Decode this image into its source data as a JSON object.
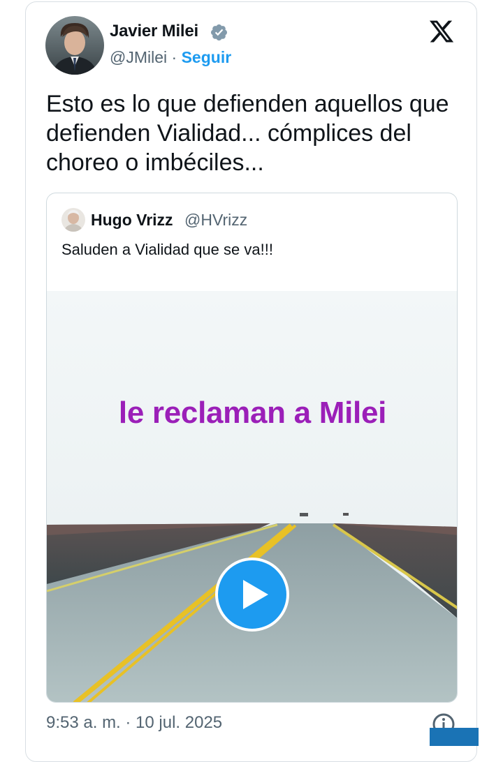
{
  "author": {
    "name": "Javier Milei",
    "handle": "@JMilei",
    "separator": "·",
    "follow_label": "Seguir"
  },
  "tweet": {
    "text": "Esto es lo que defienden aquellos que defienden Vialidad... cómplices del choreo o imbéciles..."
  },
  "quoted": {
    "name": "Hugo Vrizz",
    "handle": "@HVrizz",
    "text": "Saluden a Vialidad que se va!!!",
    "video_overlay_text": "le reclaman a Milei"
  },
  "footer": {
    "timestamp": "9:53 a. m. · 10 jul. 2025"
  },
  "icons": {
    "verified": "verified-badge-icon",
    "brand": "x-logo-icon",
    "play": "play-icon",
    "info": "info-icon"
  },
  "colors": {
    "link": "#1d9bf0",
    "secondary_text": "#536471",
    "overlay_text": "#9b1fb8",
    "play_button": "#1d9bf0"
  }
}
